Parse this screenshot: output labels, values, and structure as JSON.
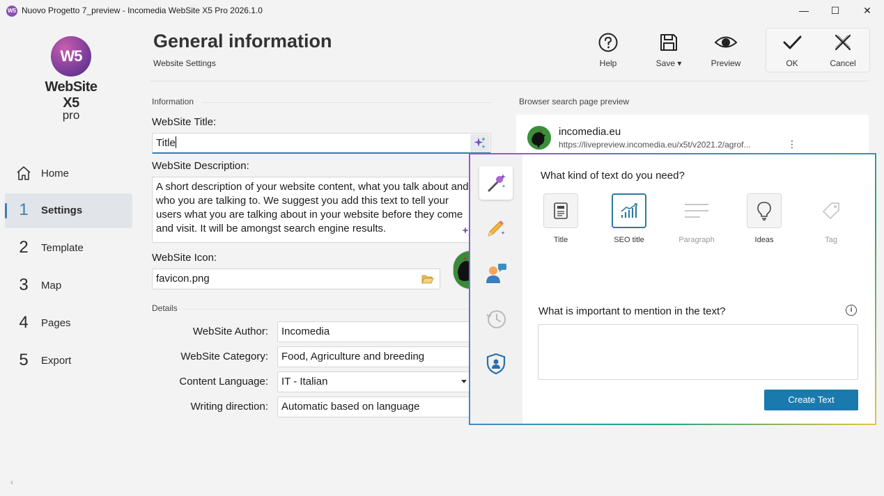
{
  "window": {
    "app_icon_text": "W5",
    "title": "Nuovo Progetto 7_preview - Incomedia WebSite X5 Pro 2026.1.0",
    "minimize": "—",
    "maximize": "☐",
    "close": "✕"
  },
  "logo": {
    "mark": "W5",
    "name": "WebSite X5",
    "edition": "pro"
  },
  "nav": {
    "items": [
      {
        "num": "",
        "label": "Home"
      },
      {
        "num": "1",
        "label": "Settings"
      },
      {
        "num": "2",
        "label": "Template"
      },
      {
        "num": "3",
        "label": "Map"
      },
      {
        "num": "4",
        "label": "Pages"
      },
      {
        "num": "5",
        "label": "Export"
      }
    ],
    "active_index": 1,
    "back": "‹"
  },
  "header": {
    "title": "General information",
    "subtitle": "Website Settings",
    "help": "Help",
    "save": "Save ▾",
    "preview": "Preview",
    "ok": "OK",
    "cancel": "Cancel"
  },
  "info": {
    "section": "Information",
    "title_label": "WebSite Title:",
    "title_value": "Title",
    "desc_label": "WebSite Description:",
    "desc_value": "A short description of your website content, what you talk about and who you are talking to. We suggest you add  this text to tell your users what you are talking about in your website before they come and visit. It will be amongst search engine results.",
    "icon_label": "WebSite Icon:",
    "icon_value": "favicon.png"
  },
  "details": {
    "section": "Details",
    "author_label": "WebSite Author:",
    "author_value": "Incomedia",
    "category_label": "WebSite Category:",
    "category_value": "Food, Agriculture and breeding",
    "language_label": "Content Language:",
    "language_value": "IT - Italian",
    "direction_label": "Writing direction:",
    "direction_value": "Automatic based on language"
  },
  "browser_preview": {
    "section": "Browser search page preview",
    "domain": "incomedia.eu",
    "url": "https://livepreview.incomedia.eu/x5t/v2021.2/agrof...",
    "menu": "⋮"
  },
  "ai_panel": {
    "question1": "What kind of text do you need?",
    "types": [
      {
        "label": "Title",
        "icon": "document-icon",
        "state": "normal"
      },
      {
        "label": "SEO title",
        "icon": "seo-chart-icon",
        "state": "selected"
      },
      {
        "label": "Paragraph",
        "icon": "paragraph-icon",
        "state": "disabled"
      },
      {
        "label": "Ideas",
        "icon": "lightbulb-icon",
        "state": "normal"
      },
      {
        "label": "Tag",
        "icon": "tag-icon",
        "state": "disabled"
      }
    ],
    "question2": "What is important to mention in the text?",
    "info": "i",
    "textarea_value": "",
    "create_button": "Create Text",
    "rail": [
      "magic-wand-icon",
      "pencil-sparkle-icon",
      "chat-person-icon",
      "history-icon",
      "shield-user-icon"
    ]
  },
  "colors": {
    "accent": "#1b7aad",
    "nav_active": "#3c7fb1",
    "panel_gradient": [
      "#9a57c9",
      "#3a8fc0",
      "#2aa37a",
      "#e7c24a"
    ]
  }
}
